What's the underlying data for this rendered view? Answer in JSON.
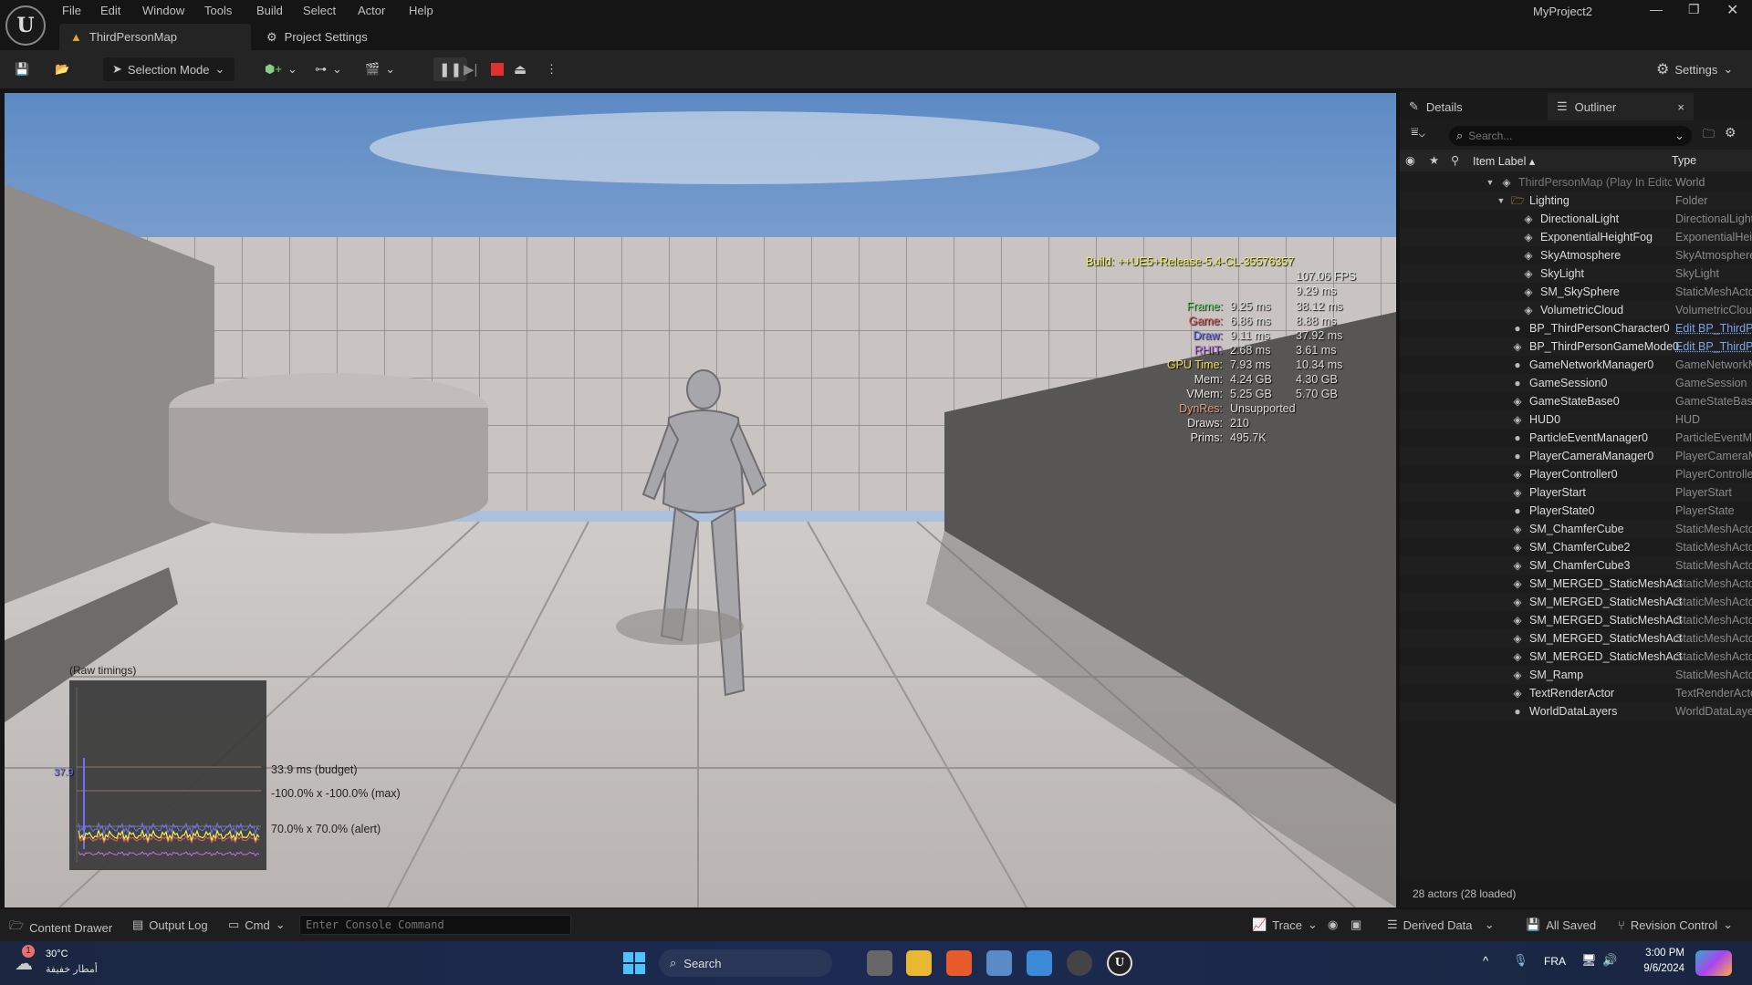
{
  "app": {
    "project": "MyProject2",
    "menu": [
      "File",
      "Edit",
      "Window",
      "Tools",
      "Build",
      "Select",
      "Actor",
      "Help"
    ],
    "tabs": [
      {
        "label": "ThirdPersonMap",
        "icon": "level-icon"
      },
      {
        "label": "Project Settings",
        "icon": "settings-cube-icon"
      }
    ]
  },
  "toolbar": {
    "selection_mode": "Selection Mode",
    "settings": "Settings"
  },
  "stats": {
    "build": "Build: ++UE5+Release-5.4-CL-35576357",
    "fps": "107.06 FPS",
    "frame_ms": "9.29 ms",
    "rows": [
      {
        "label": "Frame:",
        "v1": "9.25 ms",
        "v2": "38.12 ms",
        "color": "#7fe07f"
      },
      {
        "label": "Game:",
        "v1": "6.86 ms",
        "v2": "8.88 ms",
        "color": "#e06060"
      },
      {
        "label": "Draw:",
        "v1": "9.11 ms",
        "v2": "37.92 ms",
        "color": "#7070ff"
      },
      {
        "label": "RHIT:",
        "v1": "2.68 ms",
        "v2": "3.61 ms",
        "color": "#c070e0"
      },
      {
        "label": "GPU Time:",
        "v1": "7.93 ms",
        "v2": "10.34 ms",
        "color": "#f0e060"
      },
      {
        "label": "Mem:",
        "v1": "4.24 GB",
        "v2": "4.30 GB",
        "color": "#e8e8e8"
      },
      {
        "label": "VMem:",
        "v1": "5.25 GB",
        "v2": "5.70 GB",
        "color": "#e8e8e8"
      },
      {
        "label": "DynRes:",
        "v1": "Unsupported",
        "v2": "",
        "color": "#e0a080"
      },
      {
        "label": "Draws:",
        "v1": "210",
        "v2": "",
        "color": "#e8e8e8"
      },
      {
        "label": "Prims:",
        "v1": "495.7K",
        "v2": "",
        "color": "#e8e8e8"
      }
    ]
  },
  "graph": {
    "title": "(Raw timings)",
    "peak": "37.9",
    "budget": "33.9 ms (budget)",
    "max": "-100.0% x -100.0% (max)",
    "alert": "70.0% x 70.0% (alert)"
  },
  "panel": {
    "details_tab": "Details",
    "outliner_tab": "Outliner",
    "search_placeholder": "Search...",
    "col_label": "Item Label",
    "col_type": "Type",
    "footer": "28 actors (28 loaded)",
    "items": [
      {
        "name": "ThirdPersonMap (Play In Editor)",
        "type": "World",
        "indent": 0,
        "icon": "world-icon",
        "dim": true,
        "arrow": true
      },
      {
        "name": "Lighting",
        "type": "Folder",
        "indent": 1,
        "icon": "folder-icon",
        "arrow": true
      },
      {
        "name": "DirectionalLight",
        "type": "DirectionalLight",
        "indent": 2,
        "icon": "directional-light-icon"
      },
      {
        "name": "ExponentialHeightFog",
        "type": "ExponentialHeightFog",
        "indent": 2,
        "icon": "fog-icon"
      },
      {
        "name": "SkyAtmosphere",
        "type": "SkyAtmosphere",
        "indent": 2,
        "icon": "sky-atmosphere-icon"
      },
      {
        "name": "SkyLight",
        "type": "SkyLight",
        "indent": 2,
        "icon": "skylight-icon"
      },
      {
        "name": "SM_SkySphere",
        "type": "StaticMeshActor",
        "indent": 2,
        "icon": "static-mesh-icon"
      },
      {
        "name": "VolumetricCloud",
        "type": "VolumetricCloud",
        "indent": 2,
        "icon": "cloud-icon"
      },
      {
        "name": "BP_ThirdPersonCharacter0",
        "type": "Edit BP_ThirdPersonCharacter",
        "indent": 1,
        "icon": "character-icon",
        "link": true
      },
      {
        "name": "BP_ThirdPersonGameMode0",
        "type": "Edit BP_ThirdPersonGameMode",
        "indent": 1,
        "icon": "gamemode-icon",
        "link": true
      },
      {
        "name": "GameNetworkManager0",
        "type": "GameNetworkManager",
        "indent": 1,
        "icon": "actor-icon"
      },
      {
        "name": "GameSession0",
        "type": "GameSession",
        "indent": 1,
        "icon": "actor-icon"
      },
      {
        "name": "GameStateBase0",
        "type": "GameStateBase",
        "indent": 1,
        "icon": "gamestate-icon"
      },
      {
        "name": "HUD0",
        "type": "HUD",
        "indent": 1,
        "icon": "hud-icon"
      },
      {
        "name": "ParticleEventManager0",
        "type": "ParticleEventManager",
        "indent": 1,
        "icon": "actor-icon"
      },
      {
        "name": "PlayerCameraManager0",
        "type": "PlayerCameraManager",
        "indent": 1,
        "icon": "actor-icon"
      },
      {
        "name": "PlayerController0",
        "type": "PlayerController",
        "indent": 1,
        "icon": "gamepad-icon"
      },
      {
        "name": "PlayerStart",
        "type": "PlayerStart",
        "indent": 1,
        "icon": "player-start-icon"
      },
      {
        "name": "PlayerState0",
        "type": "PlayerState",
        "indent": 1,
        "icon": "actor-icon"
      },
      {
        "name": "SM_ChamferCube",
        "type": "StaticMeshActor",
        "indent": 1,
        "icon": "static-mesh-icon"
      },
      {
        "name": "SM_ChamferCube2",
        "type": "StaticMeshActor",
        "indent": 1,
        "icon": "static-mesh-icon"
      },
      {
        "name": "SM_ChamferCube3",
        "type": "StaticMeshActor",
        "indent": 1,
        "icon": "static-mesh-icon"
      },
      {
        "name": "SM_MERGED_StaticMeshActor",
        "type": "StaticMeshActor",
        "indent": 1,
        "icon": "static-mesh-icon"
      },
      {
        "name": "SM_MERGED_StaticMeshActor",
        "type": "StaticMeshActor",
        "indent": 1,
        "icon": "static-mesh-icon"
      },
      {
        "name": "SM_MERGED_StaticMeshActor",
        "type": "StaticMeshActor",
        "indent": 1,
        "icon": "static-mesh-icon"
      },
      {
        "name": "SM_MERGED_StaticMeshActor",
        "type": "StaticMeshActor",
        "indent": 1,
        "icon": "static-mesh-icon"
      },
      {
        "name": "SM_MERGED_StaticMeshActor",
        "type": "StaticMeshActor",
        "indent": 1,
        "icon": "static-mesh-icon"
      },
      {
        "name": "SM_Ramp",
        "type": "StaticMeshActor",
        "indent": 1,
        "icon": "static-mesh-icon"
      },
      {
        "name": "TextRenderActor",
        "type": "TextRenderActor",
        "indent": 1,
        "icon": "text-render-icon"
      },
      {
        "name": "WorldDataLayers",
        "type": "WorldDataLayers",
        "indent": 1,
        "icon": "actor-icon"
      }
    ]
  },
  "bottombar": {
    "content_drawer": "Content Drawer",
    "output_log": "Output Log",
    "cmd": "Cmd",
    "console_placeholder": "Enter Console Command",
    "trace": "Trace",
    "derived_data": "Derived Data",
    "all_saved": "All Saved",
    "revision_control": "Revision Control"
  },
  "taskbar": {
    "temp": "30°C",
    "weather": "أمطار خفيفة",
    "badge": "1",
    "search": "Search",
    "lang": "FRA",
    "time": "3:00 PM",
    "date": "9/6/2024"
  }
}
